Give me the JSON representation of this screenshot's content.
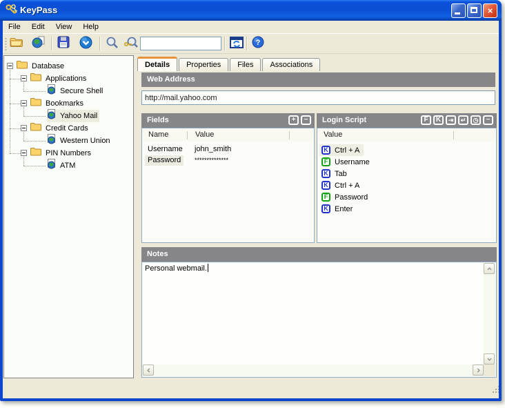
{
  "window": {
    "title": "KeyPass",
    "icon": "keys-icon",
    "buttons": [
      {
        "name": "minimize",
        "glyph": ""
      },
      {
        "name": "maximize",
        "glyph": ""
      },
      {
        "name": "close",
        "glyph": "×"
      }
    ]
  },
  "menu_bar": {
    "items": [
      "File",
      "Edit",
      "View",
      "Help"
    ]
  },
  "toolbar": {
    "buttons": [
      {
        "name": "open",
        "icon": "folder-open-icon"
      },
      {
        "name": "new-web-entry",
        "icon": "web-entry-icon"
      },
      {
        "name": "save",
        "icon": "save-icon"
      },
      {
        "name": "commit",
        "icon": "blue-orb-icon"
      },
      {
        "name": "search",
        "icon": "search-icon"
      },
      {
        "name": "search-key",
        "icon": "search-key-icon"
      },
      {
        "name": "auto-type",
        "icon": "browser-window-icon"
      },
      {
        "name": "help",
        "icon": "help-icon"
      }
    ],
    "search_input": {
      "value": ""
    }
  },
  "tree": {
    "items": [
      {
        "label": "Database",
        "level": 0,
        "type": "folder",
        "expanded": true
      },
      {
        "label": "Applications",
        "level": 1,
        "type": "folder",
        "expanded": true
      },
      {
        "label": "Secure Shell",
        "level": 2,
        "type": "entry"
      },
      {
        "label": "Bookmarks",
        "level": 1,
        "type": "folder",
        "expanded": true
      },
      {
        "label": "Yahoo Mail",
        "level": 2,
        "type": "entry",
        "selected": true
      },
      {
        "label": "Credit Cards",
        "level": 1,
        "type": "folder",
        "expanded": true
      },
      {
        "label": "Western Union",
        "level": 2,
        "type": "entry"
      },
      {
        "label": "PIN Numbers",
        "level": 1,
        "type": "folder",
        "expanded": true
      },
      {
        "label": "ATM",
        "level": 2,
        "type": "entry"
      }
    ]
  },
  "tabs": [
    {
      "label": "Details",
      "active": true
    },
    {
      "label": "Properties",
      "active": false
    },
    {
      "label": "Files",
      "active": false
    },
    {
      "label": "Associations",
      "active": false
    }
  ],
  "web_address": {
    "header": "Web Address",
    "value": "http://mail.yahoo.com"
  },
  "fields": {
    "header": "Fields",
    "buttons": [
      {
        "name": "add-field",
        "glyph": "+"
      },
      {
        "name": "remove-field",
        "glyph": "−"
      }
    ],
    "columns": [
      "Name",
      "Value"
    ],
    "rows": [
      {
        "name": "Username",
        "value": "john_smith",
        "masked": false,
        "selected": false
      },
      {
        "name": "Password",
        "value": "**************",
        "masked": true,
        "selected": true
      }
    ]
  },
  "login_script": {
    "header": "Login Script",
    "buttons": [
      {
        "name": "insert-field",
        "glyph": "F"
      },
      {
        "name": "insert-key",
        "glyph": "K"
      },
      {
        "name": "insert-tab",
        "glyph": "⇥"
      },
      {
        "name": "insert-enter",
        "glyph": "↵"
      },
      {
        "name": "insert-delay",
        "glyph": "◷"
      },
      {
        "name": "remove-step",
        "glyph": "−"
      }
    ],
    "columns": [
      "Value"
    ],
    "items": [
      {
        "badge": "K",
        "label": "Ctrl + A",
        "selected": true
      },
      {
        "badge": "F",
        "label": "Username",
        "selected": false
      },
      {
        "badge": "K",
        "label": "Tab",
        "selected": false
      },
      {
        "badge": "K",
        "label": "Ctrl + A",
        "selected": false
      },
      {
        "badge": "F",
        "label": "Password",
        "selected": false
      },
      {
        "badge": "K",
        "label": "Enter",
        "selected": false
      }
    ]
  },
  "notes": {
    "header": "Notes",
    "value": "Personal webmail."
  },
  "colors": {
    "titlebar_blue": "#0A4FD6",
    "window_border": "#0D47CE",
    "chrome_beige": "#ECE9D8",
    "section_header_gray": "#868589",
    "panel_bg": "#FCFDF8",
    "selection_beige": "#EDECDF",
    "tab_active_top": "#E8923D",
    "key_badge_blue": "#2233CC",
    "field_badge_green": "#11A211",
    "input_border": "#7F9DB9",
    "close_button_red": "#E25A3A"
  }
}
